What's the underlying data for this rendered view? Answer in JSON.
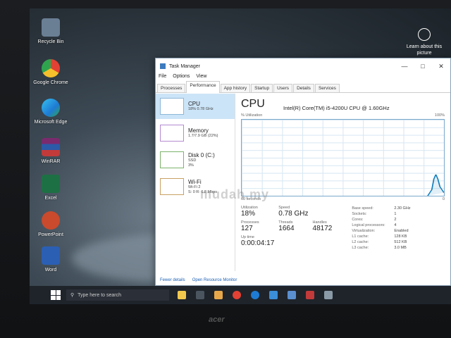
{
  "desktop": {
    "icons": [
      {
        "label": "Recycle Bin"
      },
      {
        "label": "Google Chrome"
      },
      {
        "label": "Microsoft Edge"
      },
      {
        "label": "WinRAR"
      },
      {
        "label": "Excel"
      },
      {
        "label": "PowerPoint"
      },
      {
        "label": "Word"
      }
    ],
    "learn_about": "Learn about this picture"
  },
  "task_manager": {
    "title": "Task Manager",
    "menu": [
      "File",
      "Options",
      "View"
    ],
    "tabs": [
      "Processes",
      "Performance",
      "App history",
      "Startup",
      "Users",
      "Details",
      "Services"
    ],
    "resources": [
      {
        "name": "CPU",
        "sub1": "18% 0.78 GHz",
        "sub2": ""
      },
      {
        "name": "Memory",
        "sub1": "1.7/7.9 GB (22%)",
        "sub2": ""
      },
      {
        "name": "Disk 0 (C:)",
        "sub1": "SSD",
        "sub2": "3%"
      },
      {
        "name": "Wi-Fi",
        "sub1": "Wi-Fi 2",
        "sub2": "S: 0 R: 6.8 Mbps"
      }
    ],
    "cpu": {
      "title": "CPU",
      "model": "Intel(R) Core(TM) i5-4200U CPU @ 1.60GHz",
      "util_label": "% Utilization",
      "util_max": "100%",
      "axis_left": "60 seconds",
      "axis_right": "0",
      "utilization_label": "Utilization",
      "utilization": "18%",
      "speed_label": "Speed",
      "speed": "0.78 GHz",
      "processes_label": "Processes",
      "processes": "127",
      "threads_label": "Threads",
      "threads": "1664",
      "handles_label": "Handles",
      "handles": "48172",
      "uptime_label": "Up time",
      "uptime": "0:00:04:17",
      "specs": [
        {
          "k": "Base speed:",
          "v": "2.30 GHz"
        },
        {
          "k": "Sockets:",
          "v": "1"
        },
        {
          "k": "Cores:",
          "v": "2"
        },
        {
          "k": "Logical processors:",
          "v": "4"
        },
        {
          "k": "Virtualization:",
          "v": "Enabled"
        },
        {
          "k": "L1 cache:",
          "v": "128 KB"
        },
        {
          "k": "L2 cache:",
          "v": "512 KB"
        },
        {
          "k": "L3 cache:",
          "v": "3.0 MB"
        }
      ]
    },
    "footer": {
      "fewer": "Fewer details",
      "monitor": "Open Resource Monitor"
    }
  },
  "watermark": "mudah.my",
  "taskbar": {
    "search_placeholder": "Type here to search"
  },
  "brand": "acer"
}
